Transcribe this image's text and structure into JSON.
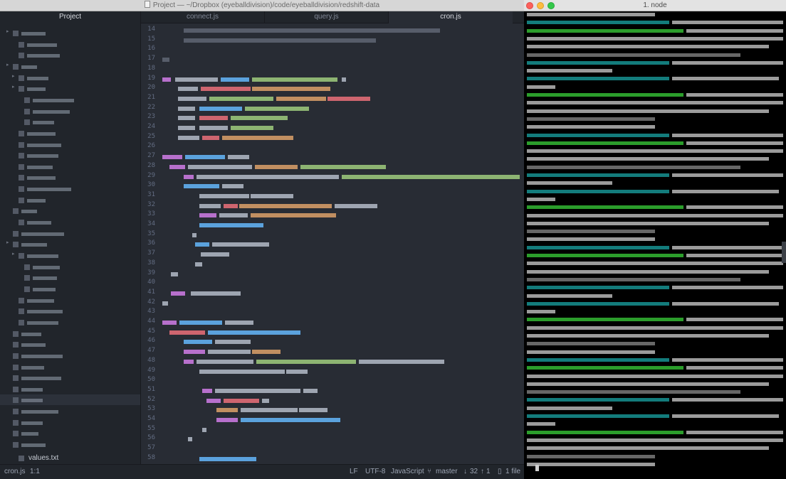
{
  "editor": {
    "window_title": "Project — ~/Dropbox (eyeballdivision)/code/eyeballdivision/redshift-data",
    "tabs": [
      {
        "label": "Project"
      },
      {
        "label": "connect.js"
      },
      {
        "label": "query.js"
      },
      {
        "label": "cron.js"
      }
    ],
    "active_tab": "cron.js",
    "tree": {
      "visible_file": "values.txt"
    },
    "line_numbers": [
      "14",
      "15",
      "16",
      "17",
      "18",
      "19",
      "20",
      "21",
      "22",
      "23",
      "24",
      "25",
      "26",
      "27",
      "28",
      "29",
      "30",
      "31",
      "32",
      "33",
      "34",
      "35",
      "36",
      "37",
      "38",
      "39",
      "40",
      "41",
      "42",
      "43",
      "44",
      "45",
      "46",
      "47",
      "48",
      "49",
      "50",
      "51",
      "52",
      "53",
      "54",
      "55",
      "56",
      "57",
      "58"
    ]
  },
  "status": {
    "file": "cron.js",
    "cursor": "1:1",
    "line_ending": "LF",
    "encoding": "UTF-8",
    "grammar": "JavaScript",
    "branch": "master",
    "git_ahead": "32",
    "git_behind": "1",
    "changed_files": "1 file"
  },
  "terminal": {
    "title": "1. node"
  },
  "colors": {
    "editor_bg": "#282c34",
    "sidebar_bg": "#21252b",
    "terminal_bg": "#000000",
    "syntax_purple": "#c678dd",
    "syntax_green": "#98c379",
    "syntax_blue": "#61afef",
    "syntax_orange": "#d19a66",
    "syntax_red": "#e06c75",
    "terminal_cyan": "#19a5a5",
    "terminal_green": "#3ad13a"
  }
}
